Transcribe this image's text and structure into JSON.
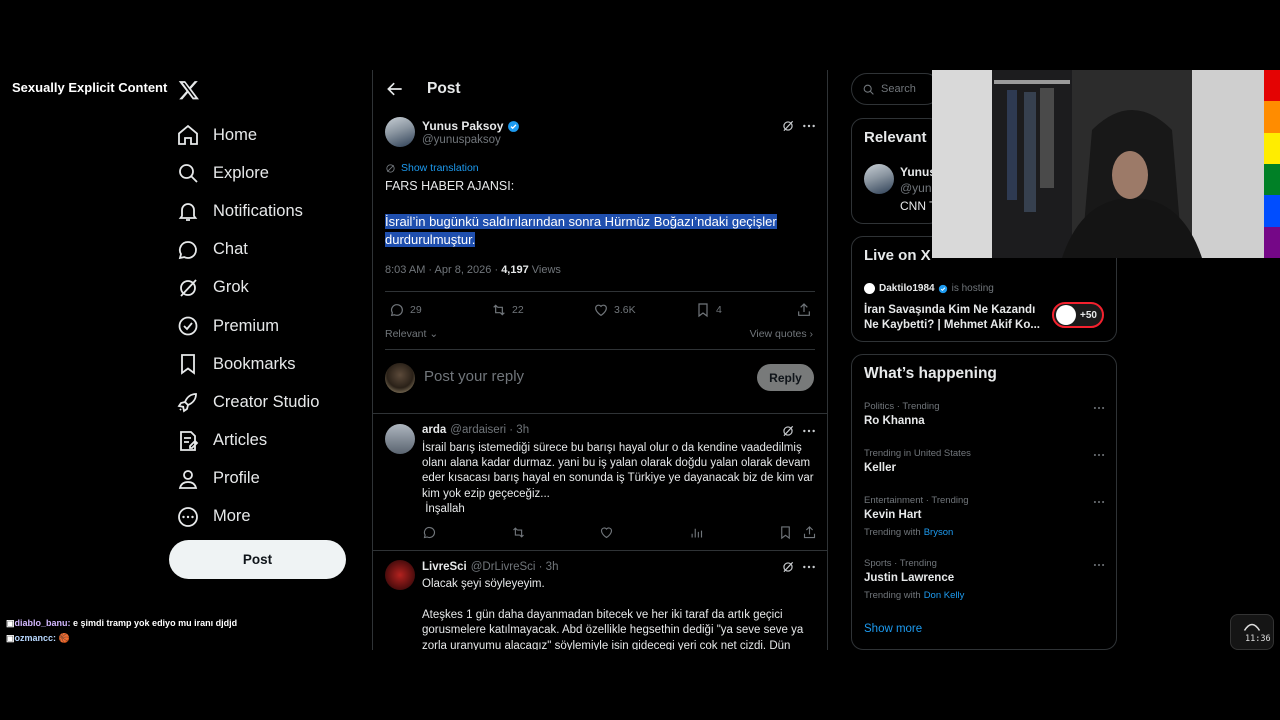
{
  "overlay": {
    "content_warning": "Sexually Explicit Content"
  },
  "nav": {
    "items": [
      {
        "label": "Home",
        "icon": "home-icon"
      },
      {
        "label": "Explore",
        "icon": "search-icon"
      },
      {
        "label": "Notifications",
        "icon": "bell-icon"
      },
      {
        "label": "Chat",
        "icon": "chat-bubble-icon"
      },
      {
        "label": "Grok",
        "icon": "grok-icon"
      },
      {
        "label": "Premium",
        "icon": "premium-badge-icon"
      },
      {
        "label": "Bookmarks",
        "icon": "bookmark-icon"
      },
      {
        "label": "Creator Studio",
        "icon": "rocket-icon"
      },
      {
        "label": "Articles",
        "icon": "article-icon"
      },
      {
        "label": "Profile",
        "icon": "person-icon"
      },
      {
        "label": "More",
        "icon": "more-circle-icon"
      }
    ],
    "post_label": "Post"
  },
  "chat_overlay": [
    {
      "user": "diablo_banu:",
      "message": "e şimdi tramp yok ediyo mu iranı djdjd"
    },
    {
      "user": "ozmancc:",
      "message": "🏀"
    }
  ],
  "main": {
    "header_title": "Post",
    "post": {
      "author_name": "Yunus Paksoy",
      "author_handle": "@yunuspaksoy",
      "show_translation": "Show translation",
      "text_line1": "FARS HABER AJANSI:",
      "text_highlight_1": "İsrail’in bugünkü saldırılarından sonra Hürmüz Boğazı’ndaki geçişler",
      "text_highlight_2": "durdurulmuştur.",
      "time": "8:03 AM · Apr 8, 2026 · ",
      "views_count": "4,197",
      "views_label": " Views",
      "replies": "29",
      "reposts": "22",
      "likes": "3.6K",
      "bookmarks": "4",
      "sort_label": "Relevant",
      "view_quotes": "View quotes"
    },
    "reply_box": {
      "placeholder": "Post your reply",
      "button": "Reply"
    },
    "comments": [
      {
        "name": "arda",
        "handle": "@ardaiseri · 3h",
        "lines": [
          "İsrail barış istemediği sürece  bu barışı hayal olur o da kendine vaadedilmiş",
          "olanı alana kadar durmaz. yani bu iş yalan olarak doğdu yalan olarak devam",
          "eder kısacası barış hayal en sonunda iş Türkiye ye dayanacak biz de kim var",
          "kim yok ezip geçeceğiz...",
          " İnşallah"
        ]
      },
      {
        "name": "LivreSci",
        "handle": "@DrLivreSci · 3h",
        "lines": [
          "Olacak şeyi söyleyeyim.",
          "",
          "Ateşkes 1 gün daha dayanmadan bitecek ve her iki taraf da artık geçici",
          "gorusmelere katılmayacak. Abd özellikle hegsethin dediği \"ya seve seve ya",
          "zorla uranyumu alacagız\" söylemiyle isin gidecegi yeri cok net cizdi. Dün"
        ]
      }
    ]
  },
  "right": {
    "search_placeholder": "Search",
    "relevant": {
      "title": "Relevant",
      "name": "Yunus",
      "handle": "@yunu",
      "bio": "CNN T"
    },
    "live": {
      "title": "Live on X",
      "host": "Daktilo1984",
      "hosting": "is hosting",
      "topic": "İran Savaşında Kim Ne Kazandı Ne Kaybetti? | Mehmet Akif Ko...",
      "listeners": "+50"
    },
    "happening": {
      "title": "What’s happening",
      "trends": [
        {
          "category": "Politics · Trending",
          "name": "Ro Khanna"
        },
        {
          "category": "Trending in United States",
          "name": "Keller"
        },
        {
          "category": "Entertainment · Trending",
          "name": "Kevin Hart",
          "with_label": "Trending with",
          "with": "Bryson"
        },
        {
          "category": "Sports · Trending",
          "name": "Justin Lawrence",
          "with_label": "Trending with",
          "with": "Don Kelly"
        }
      ],
      "show_more": "Show more"
    }
  },
  "clock": {
    "time": "11:36"
  },
  "colors": {
    "accent": "#1d9bf0",
    "highlight": "#1f4fae",
    "live_ring": "#f4212e"
  }
}
